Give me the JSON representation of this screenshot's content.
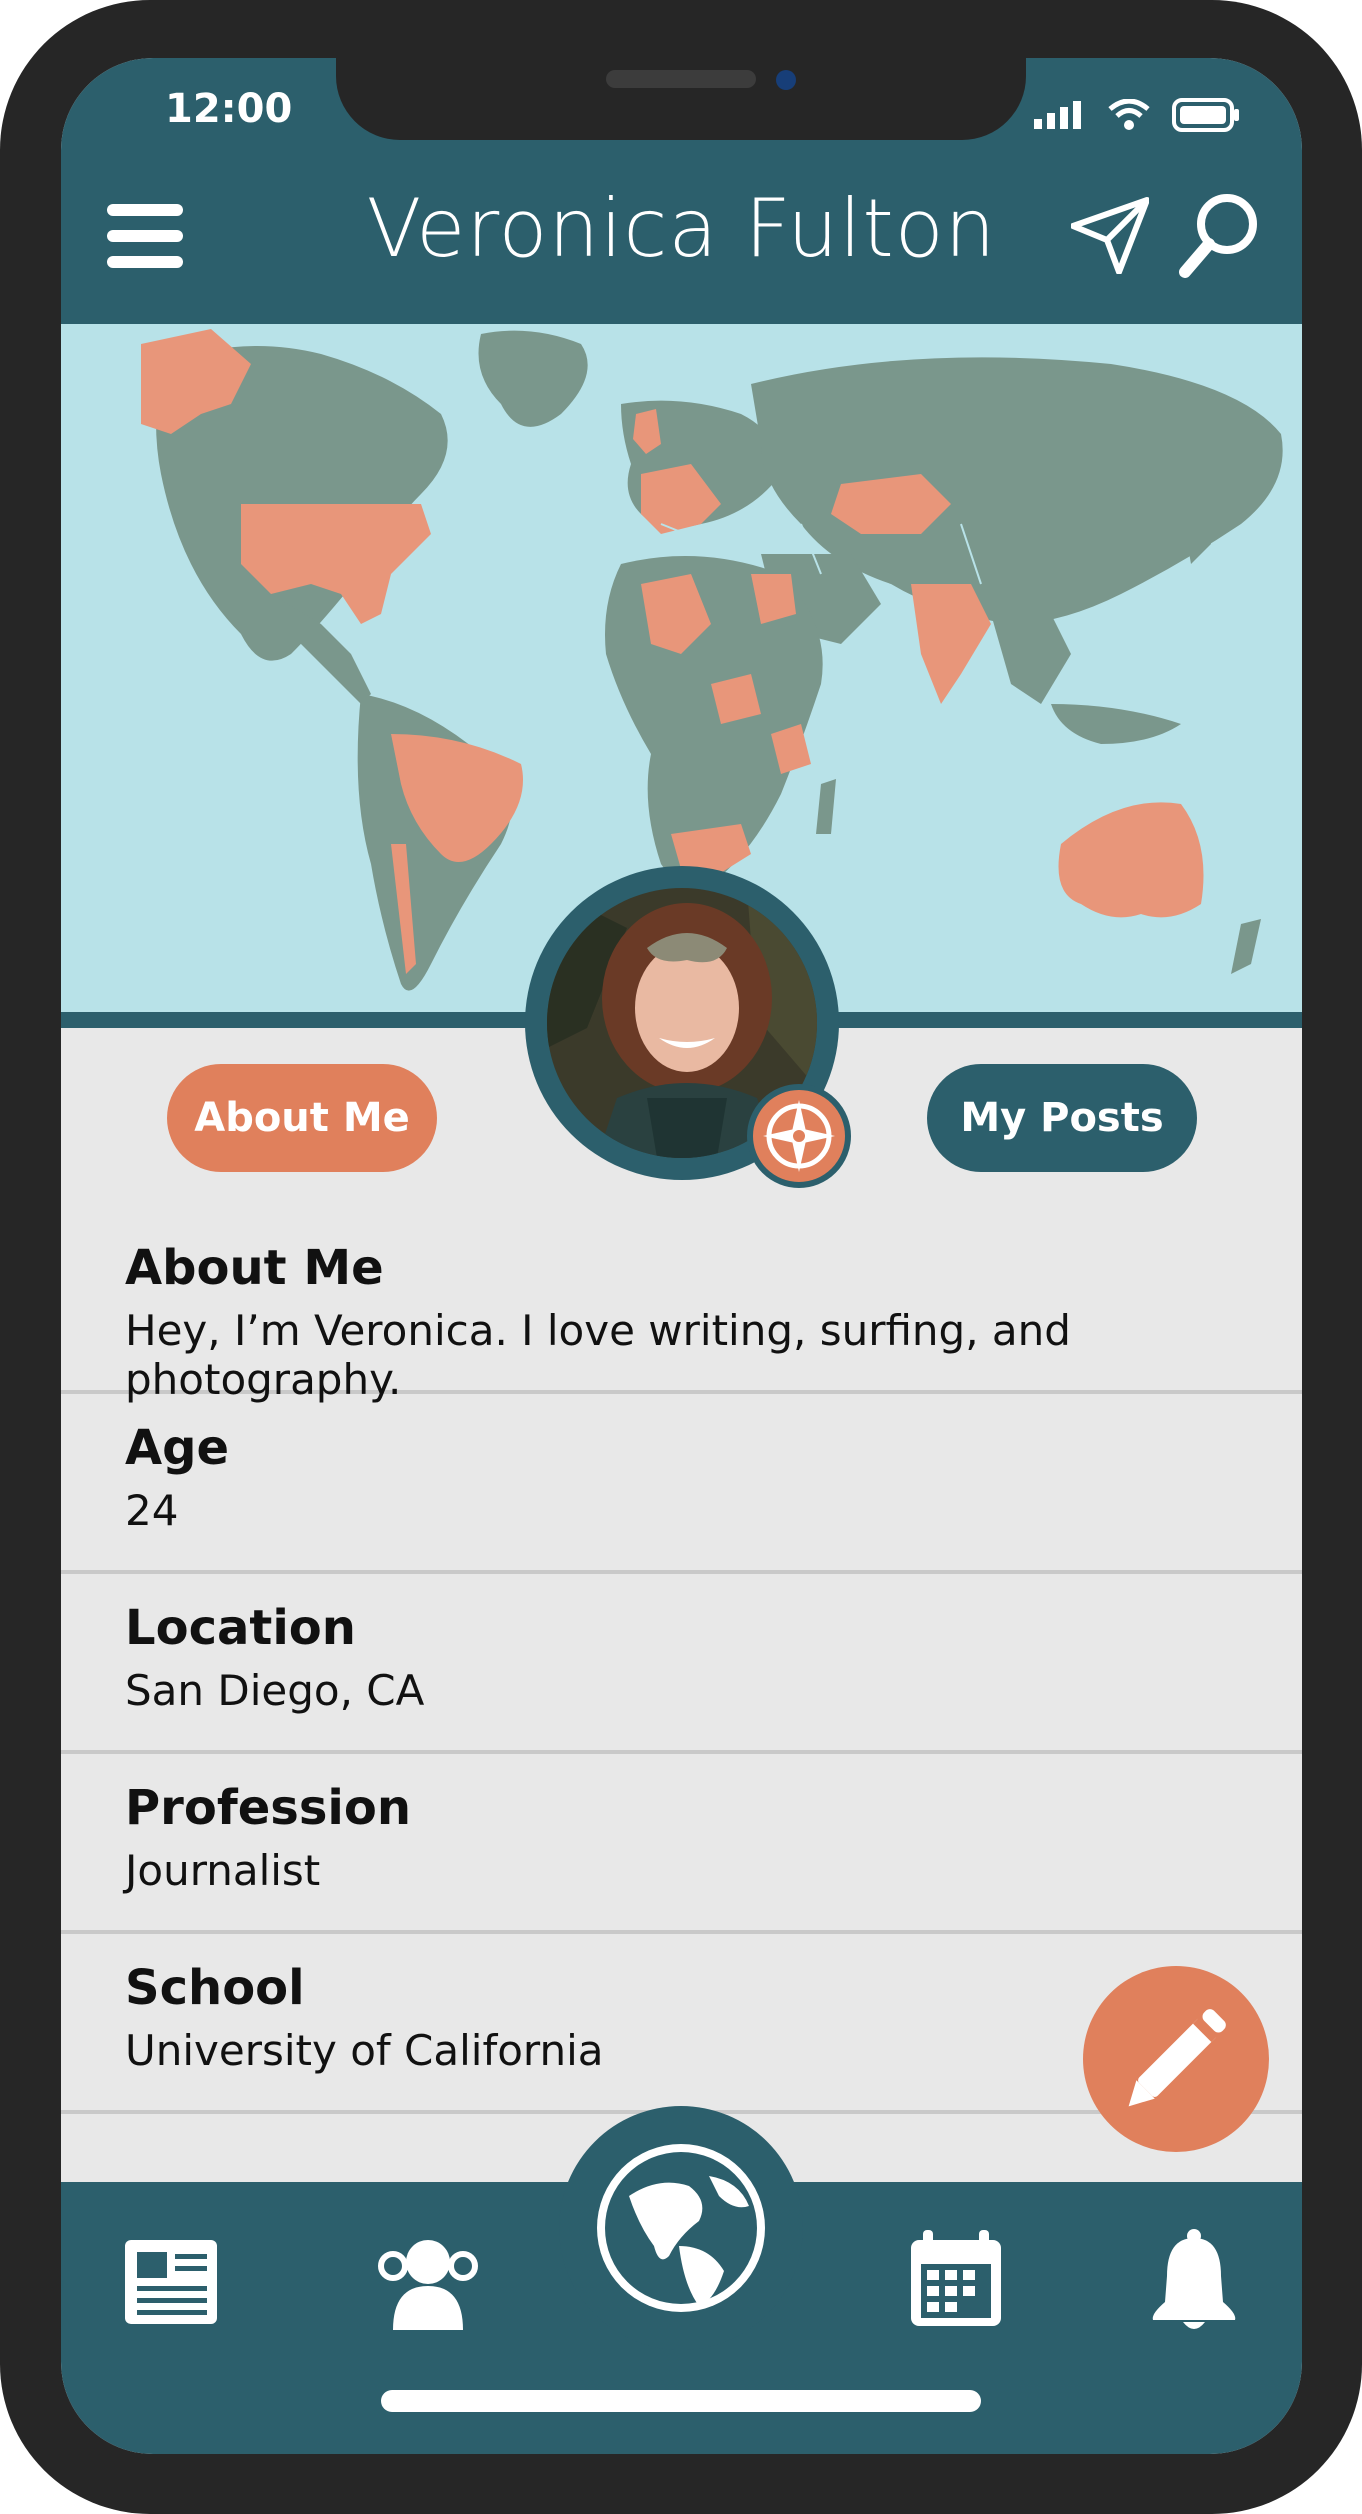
{
  "status_bar": {
    "time": "12:00"
  },
  "header": {
    "title": "Veronica Fulton"
  },
  "profile_tabs": {
    "about_label": "About Me",
    "posts_label": "My Posts"
  },
  "profile_fields": [
    {
      "label": "About Me",
      "value": "Hey, I’m Veronica. I love writing, surfing, and photography."
    },
    {
      "label": "Age",
      "value": "24"
    },
    {
      "label": "Location",
      "value": "San Diego, CA"
    },
    {
      "label": "Profession",
      "value": "Journalist"
    },
    {
      "label": "School",
      "value": "University of California"
    }
  ],
  "icons": {
    "menu": "hamburger-menu-icon",
    "send": "paper-plane-icon",
    "search": "search-icon",
    "badge": "compass-icon",
    "fab": "pencil-icon",
    "nav": [
      "newspaper-icon",
      "people-icon",
      "globe-icon",
      "calendar-icon",
      "bell-icon"
    ]
  },
  "colors": {
    "primary": "#2c5f6c",
    "accent": "#e0805c",
    "ocean": "#b8e2e8",
    "land": "#7a978c",
    "background": "#e8e8e8"
  }
}
